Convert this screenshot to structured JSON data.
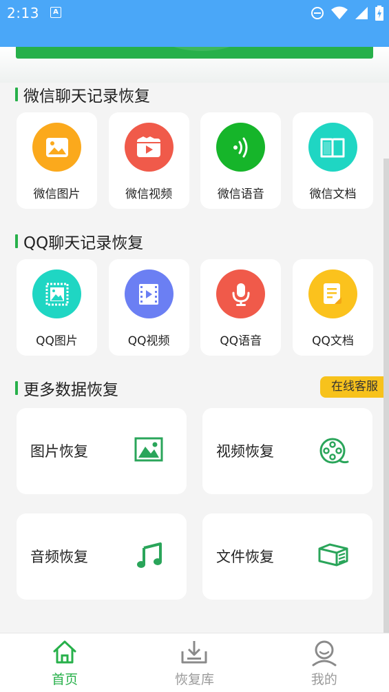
{
  "status_bar": {
    "time": "2:13",
    "notif_glyph": "A"
  },
  "sections": {
    "wechat": {
      "title": "微信聊天记录恢复",
      "items": [
        {
          "label": "微信图片",
          "icon": "image-icon",
          "color": "#fba91c"
        },
        {
          "label": "微信视频",
          "icon": "video-icon",
          "color": "#f05a4a"
        },
        {
          "label": "微信语音",
          "icon": "voice-icon",
          "color": "#16b52a"
        },
        {
          "label": "微信文档",
          "icon": "book-icon",
          "color": "#1fd6c3"
        }
      ]
    },
    "qq": {
      "title": "QQ聊天记录恢复",
      "items": [
        {
          "label": "QQ图片",
          "icon": "stamp-image-icon",
          "color": "#1fd6c3"
        },
        {
          "label": "QQ视频",
          "icon": "film-icon",
          "color": "#6b7ff3"
        },
        {
          "label": "QQ语音",
          "icon": "microphone-icon",
          "color": "#f05a4a"
        },
        {
          "label": "QQ文档",
          "icon": "document-icon",
          "color": "#fbc21d"
        }
      ]
    },
    "more": {
      "title": "更多数据恢复",
      "service_button": "在线客服",
      "items": [
        {
          "label": "图片恢复",
          "icon": "picture-icon"
        },
        {
          "label": "视频恢复",
          "icon": "film-reel-icon"
        },
        {
          "label": "音频恢复",
          "icon": "music-note-icon"
        },
        {
          "label": "文件恢复",
          "icon": "file-stack-icon"
        }
      ]
    }
  },
  "bottom_nav": [
    {
      "label": "首页",
      "icon": "home-icon",
      "active": true
    },
    {
      "label": "恢复库",
      "icon": "download-tray-icon",
      "active": false
    },
    {
      "label": "我的",
      "icon": "user-icon",
      "active": false
    }
  ],
  "colors": {
    "accent": "#27b04a",
    "statusbar": "#4aa7f8",
    "badge": "#f7c21c"
  }
}
